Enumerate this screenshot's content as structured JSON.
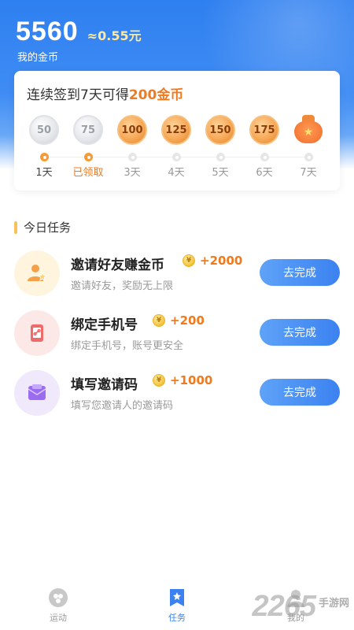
{
  "balance": {
    "coins": "5560",
    "approx": "≈0.55元",
    "label": "我的金币"
  },
  "checkin": {
    "title_prefix": "连续签到7天可得",
    "title_highlight": "200金币",
    "days": [
      {
        "value": "50",
        "label": "1天",
        "state": "done"
      },
      {
        "value": "75",
        "label": "已领取",
        "state": "claimed"
      },
      {
        "value": "100",
        "label": "3天",
        "state": "pending"
      },
      {
        "value": "125",
        "label": "4天",
        "state": "pending"
      },
      {
        "value": "150",
        "label": "5天",
        "state": "pending"
      },
      {
        "value": "175",
        "label": "6天",
        "state": "pending"
      },
      {
        "value": "",
        "label": "7天",
        "state": "bag"
      }
    ]
  },
  "tasks_section": {
    "title": "今日任务"
  },
  "tasks": [
    {
      "title": "邀请好友赚金币",
      "reward": "+2000",
      "desc": "邀请好友，奖励无上限",
      "button": "去完成",
      "icon": "user-star-icon"
    },
    {
      "title": "绑定手机号",
      "reward": "+200",
      "desc": "绑定手机号，账号更安全",
      "button": "去完成",
      "icon": "phone-link-icon"
    },
    {
      "title": "填写邀请码",
      "reward": "+1000",
      "desc": "填写您邀请人的邀请码",
      "button": "去完成",
      "icon": "envelope-icon"
    }
  ],
  "tabbar": {
    "items": [
      {
        "label": "运动",
        "icon": "sport-icon"
      },
      {
        "label": "任务",
        "icon": "bookmark-star-icon"
      },
      {
        "label": "我的",
        "icon": "profile-icon"
      }
    ]
  },
  "watermark": {
    "number": "2265",
    "site": "手游网"
  },
  "colors": {
    "primary": "#3b82f0",
    "accent": "#f07a20"
  }
}
